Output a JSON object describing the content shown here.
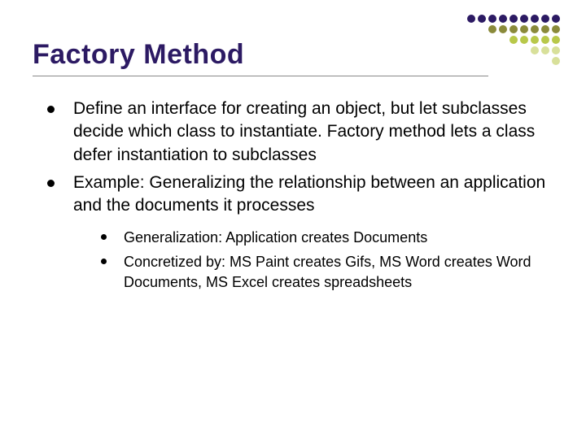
{
  "title": "Factory Method",
  "bullets": {
    "b1": "Define an interface for creating an object, but let subclasses decide which class to instantiate. Factory method lets a class defer instantiation to subclasses",
    "b2": "Example:  Generalizing the relationship between an application and the documents it processes",
    "sub1": "Generalization:  Application creates Documents",
    "sub2": "Concretized by:  MS Paint creates Gifs, MS Word creates Word Documents, MS Excel creates spreadsheets"
  },
  "decor_palette": {
    "dark": "#2c1a63",
    "olive": "#8a8a3a",
    "lime": "#b8c84a",
    "pale": "#d8e09a"
  }
}
